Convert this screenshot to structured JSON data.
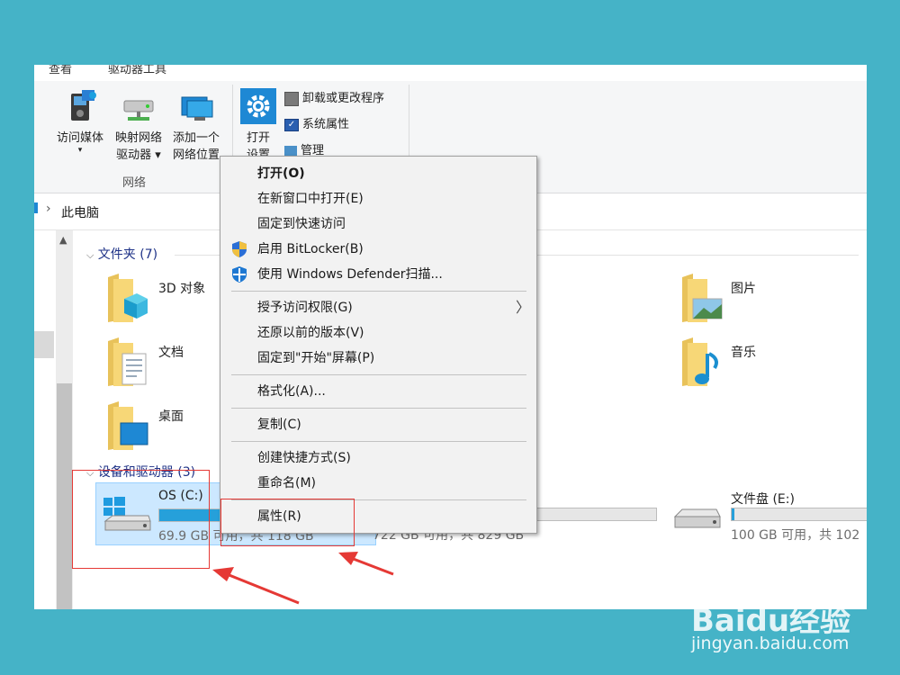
{
  "tabs": {
    "view": "查看",
    "drive_tools": "驱动器工具"
  },
  "ribbon": {
    "access_media": "访问媒体",
    "map_drive_line1": "映射网络",
    "map_drive_line2": "驱动器",
    "add_location_line1": "添加一个",
    "add_location_line2": "网络位置",
    "open_settings_line1": "打开",
    "open_settings_line2": "设置",
    "uninstall": "卸载或更改程序",
    "system_properties": "系统属性",
    "manage": "管理",
    "network_group": "网络"
  },
  "address": {
    "current": "此电脑"
  },
  "sections": {
    "folders": "文件夹 (7)",
    "devices": "设备和驱动器 (3)"
  },
  "folders": {
    "objects3d": "3D 对象",
    "documents": "文档",
    "desktop": "桌面",
    "pictures": "图片",
    "music": "音乐"
  },
  "drives": [
    {
      "name": "OS (C:)",
      "info": "69.9 GB 可用，共 118 GB",
      "usage": 0.41
    },
    {
      "name": "",
      "info": "722 GB 可用，共 829 GB",
      "usage": 0.13
    },
    {
      "name": "文件盘 (E:)",
      "info": "100 GB 可用，共 102",
      "usage": 0.02
    }
  ],
  "context_menu": {
    "open": "打开(O)",
    "open_new_window": "在新窗口中打开(E)",
    "pin_quick_access": "固定到快速访问",
    "bitlocker": "启用 BitLocker(B)",
    "defender": "使用 Windows Defender扫描...",
    "give_access": "授予访问权限(G)",
    "restore_versions": "还原以前的版本(V)",
    "pin_start": "固定到\"开始\"屏幕(P)",
    "format": "格式化(A)...",
    "copy": "复制(C)",
    "create_shortcut": "创建快捷方式(S)",
    "rename": "重命名(M)",
    "properties": "属性(R)"
  },
  "watermark": {
    "brand": "Baidu经验",
    "url": "jingyan.baidu.com"
  },
  "colors": {
    "accent": "#26a0da",
    "highlight": "#cce8ff",
    "annotation": "#e53935",
    "frame": "#45b3c7"
  }
}
